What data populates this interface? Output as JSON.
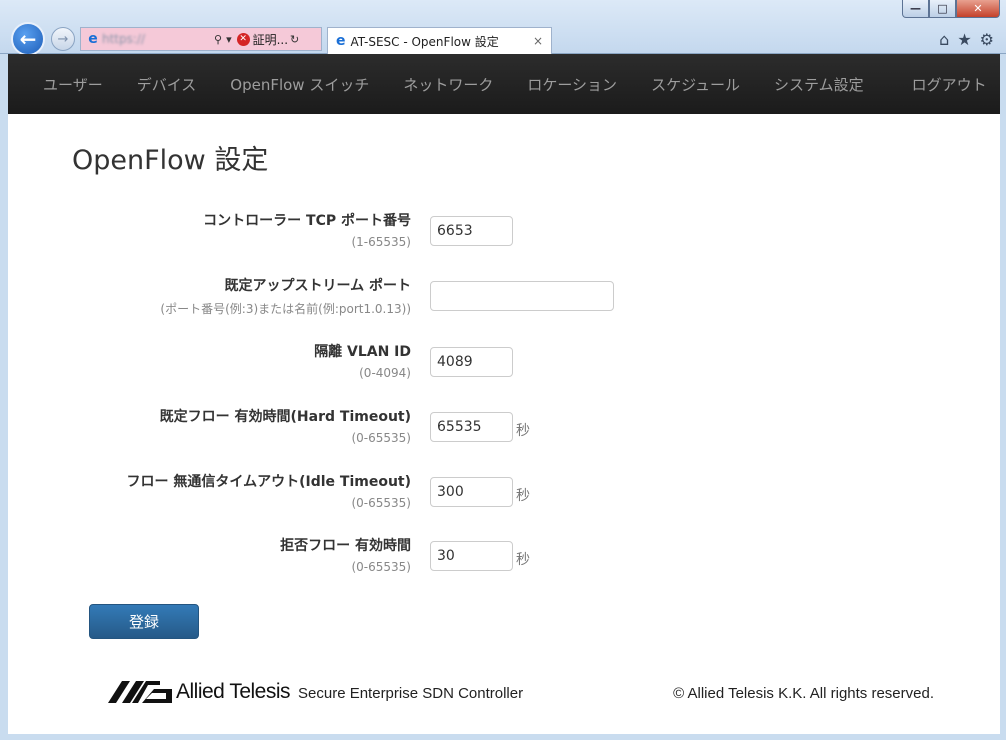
{
  "browser": {
    "back_icon": "←",
    "forward_icon": "→",
    "url_blurred": "https://",
    "cert_error": "証明...",
    "tab_title": "AT-SESC - OpenFlow 設定",
    "tab_close": "×",
    "window": {
      "min": "—",
      "max": "□",
      "close": "✕"
    },
    "tools": {
      "home": "⌂",
      "favorites": "★",
      "settings": "⚙"
    }
  },
  "navbar": {
    "items": [
      "ユーザー",
      "デバイス",
      "OpenFlow スイッチ",
      "ネットワーク",
      "ロケーション",
      "スケジュール",
      "システム設定"
    ],
    "logout": "ログアウト"
  },
  "page": {
    "title": "OpenFlow 設定"
  },
  "form": {
    "fields": [
      {
        "label": "コントローラー TCP ポート番号",
        "hint": "(1-65535)",
        "value": "6653",
        "unit": ""
      },
      {
        "label": "既定アップストリーム ポート",
        "hint": "(ポート番号(例:3)または名前(例:port1.0.13))",
        "value": "",
        "unit": ""
      },
      {
        "label": "隔離 VLAN ID",
        "hint": "(0-4094)",
        "value": "4089",
        "unit": ""
      },
      {
        "label": "既定フロー 有効時間(Hard Timeout)",
        "hint": "(0-65535)",
        "value": "65535",
        "unit": "秒"
      },
      {
        "label": "フロー 無通信タイムアウト(Idle Timeout)",
        "hint": "(0-65535)",
        "value": "300",
        "unit": "秒"
      },
      {
        "label": "拒否フロー 有効時間",
        "hint": "(0-65535)",
        "value": "30",
        "unit": "秒"
      }
    ],
    "submit_label": "登録"
  },
  "footer": {
    "brand": "Allied Telesis",
    "tagline": "Secure Enterprise SDN Controller",
    "copyright": "© Allied Telesis K.K. All rights reserved."
  }
}
